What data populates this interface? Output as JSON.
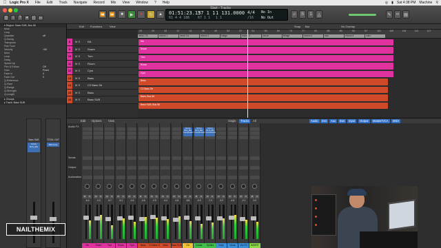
{
  "menubar": {
    "app_name": "Logic Pro X",
    "items": [
      "File",
      "Edit",
      "Track",
      "Navigate",
      "Record",
      "Mix",
      "View",
      "Window",
      "?",
      "Help"
    ],
    "clock": "Sat 4:38 PM",
    "user": "Machine"
  },
  "window": {
    "title": "Start - Tracks"
  },
  "lcd": {
    "time": "01:51:23.13",
    "time_sub": "61 4 4 186",
    "bar": "57 1 1",
    "bar_sub": "67 1 1",
    "tempo": "1 131.0000",
    "tempo_sub": "1 1",
    "sig": "4/4",
    "sig_sub": "/16",
    "key_in": "No In",
    "key_out": "No Out"
  },
  "toolbar_right": {
    "cpu_label": "Snap",
    "nodrag": "No Overlap",
    "snap_value": "Bar"
  },
  "tracks_toolbar": {
    "edit": "Edit",
    "functions": "Functions",
    "view": "View"
  },
  "inspector": {
    "region_label": "Region: Bass SUB, Bus 56",
    "rows": [
      {
        "k": "Mute",
        "v": ""
      },
      {
        "k": "Loop",
        "v": ""
      },
      {
        "k": "Quantize",
        "v": "off"
      },
      {
        "k": "Q-Swing",
        "v": ""
      },
      {
        "k": "Transpose",
        "v": ""
      },
      {
        "k": "Fine Tune",
        "v": ""
      },
      {
        "k": "Velocity",
        "v": "+50"
      },
      {
        "k": "More",
        "v": ""
      },
      {
        "k": "Loop",
        "v": ""
      },
      {
        "k": "Delay",
        "v": ""
      },
      {
        "k": "Speed Up",
        "v": ""
      },
      {
        "k": "Flex & Follow",
        "v": "Off"
      },
      {
        "k": "Gain",
        "v": "Fixed"
      },
      {
        "k": "Fade In",
        "v": "0"
      },
      {
        "k": "Fade Out",
        "v": "0"
      },
      {
        "k": "Q-Reference",
        "v": ""
      },
      {
        "k": "Q-Flam",
        "v": ""
      },
      {
        "k": "Q-Range",
        "v": ""
      },
      {
        "k": "Q-Strength",
        "v": ""
      },
      {
        "k": "Q-Length",
        "v": ""
      }
    ],
    "groups_label": "Groups",
    "track_label": "Track: Bass SUB",
    "strip_a_name": "Bass SUB",
    "strip_b_name": "TOTAL OUT",
    "strip_a_plug": "C4 Int",
    "strip_a_plug2": "NLS_Mix",
    "strip_b_plug": "SftrComp"
  },
  "ruler": {
    "ticks": [
      "25",
      "29",
      "33",
      "37",
      "41",
      "45",
      "49",
      "53",
      "57",
      "61",
      "65",
      "69",
      "73",
      "77",
      "81",
      "85",
      "89",
      "93",
      "97",
      "101",
      "105",
      "109",
      "113",
      "117"
    ],
    "markers": [
      "verse 1 B",
      "chorus 1",
      "verse 2 A",
      "chorus 2",
      "bridge",
      "chorus 3",
      "pre-ch",
      "Bridge",
      "chorus 4",
      "solo",
      "chorus 5",
      "outro"
    ]
  },
  "tracks": [
    {
      "num": "8",
      "name": "Kik",
      "color": "#e0329e",
      "region": "Kik"
    },
    {
      "num": "9",
      "name": "Snare",
      "color": "#e0329e",
      "region": "Snare"
    },
    {
      "num": "10",
      "name": "Tom",
      "color": "#e0329e",
      "region": "Tom"
    },
    {
      "num": "11",
      "name": "Room",
      "color": "#e0329e",
      "region": "Room"
    },
    {
      "num": "12",
      "name": "Cym",
      "color": "#e0329e",
      "region": "Cym"
    },
    {
      "num": "13",
      "name": "Bass",
      "color": "#d04a2a",
      "region": "Bass"
    },
    {
      "num": "14",
      "name": "C2 Bass Str",
      "color": "#d04a2a",
      "region": "C2 Bass Str"
    },
    {
      "num": "15",
      "name": "Bass",
      "color": "#d04a2a",
      "region": "Bass, Bus 56"
    },
    {
      "num": "16",
      "name": "Bass SUB",
      "color": "#d04a2a",
      "region": "Bass SUB, Bus 56"
    }
  ],
  "mixer_toolbar": {
    "edit": "Edit",
    "options": "Options",
    "view": "View",
    "single": "Single",
    "tracks": "Tracks",
    "all": "All",
    "filters": [
      "Audio",
      "Inst",
      "Aux",
      "Bus",
      "Input",
      "Output",
      "Master/VCA",
      "MIDI"
    ]
  },
  "mixer": {
    "audio_fx_label": "Audio FX",
    "sends_label": "Sends",
    "output_label": "Output",
    "automation_label": "Automation",
    "strips": [
      {
        "name": "Kik",
        "color": "#e0329e",
        "db": "-6.4",
        "level": 0.55,
        "fader": 0.62
      },
      {
        "name": "Snare",
        "color": "#e0329e",
        "db": "-2.3",
        "level": 0.7,
        "fader": 0.6
      },
      {
        "name": "Tom",
        "color": "#e0329e",
        "db": "-9.7",
        "level": 0.4,
        "fader": 0.58
      },
      {
        "name": "Room",
        "color": "#e0329e",
        "db": "-5.1",
        "level": 0.6,
        "fader": 0.61
      },
      {
        "name": "Cym",
        "color": "#e0329e",
        "db": "-1.6",
        "level": 0.5,
        "fader": 0.63
      },
      {
        "name": "Bass",
        "color": "#d04a2a",
        "db": "-3.6",
        "level": 0.65,
        "fader": 0.59
      },
      {
        "name": "C2 Bass Str",
        "color": "#d04a2a",
        "db": "-2.9",
        "level": 0.62,
        "fader": 0.64
      },
      {
        "name": "Bass",
        "color": "#d04a2a",
        "db": "-4.4",
        "level": 0.58,
        "fader": 0.6
      },
      {
        "name": "Bass SUB",
        "color": "#d04a2a",
        "db": "-1.8",
        "level": 0.66,
        "fader": 0.57
      },
      {
        "name": "Gtr",
        "color": "#f2c230",
        "db": "-5.6",
        "level": 0.52,
        "fader": 0.62
      },
      {
        "name": "Leads",
        "color": "#3fc04a",
        "db": "-0.9",
        "level": 0.45,
        "fader": 0.6
      },
      {
        "name": "Synths",
        "color": "#3fc04a",
        "db": "-7.4",
        "level": 0.48,
        "fader": 0.61
      },
      {
        "name": "Keys",
        "color": "#3a8ed8",
        "db": "-3.2",
        "level": 0.6,
        "fader": 0.6
      },
      {
        "name": "Vocal",
        "color": "#3a8ed8",
        "db": "-4.8",
        "level": 0.7,
        "fader": 0.63
      },
      {
        "name": "Vox FX",
        "color": "#3a8ed8",
        "db": "-2.1",
        "level": 0.56,
        "fader": 0.59
      },
      {
        "name": "INSERT",
        "color": "#8bd848",
        "db": "0.0",
        "level": 0.5,
        "fader": 0.6
      }
    ],
    "plugins": [
      {
        "strip": 9,
        "lines": [
          "C4 Int",
          "NLS_Mix",
          "Compressor"
        ]
      },
      {
        "strip": 10,
        "lines": [
          "C4 Int",
          "NLS_Mix",
          "Compressor"
        ]
      },
      {
        "strip": 11,
        "lines": [
          "C4 Int",
          "NLS_Mix",
          "Compressor"
        ]
      }
    ]
  },
  "watermark": "NAILTHEMIX"
}
